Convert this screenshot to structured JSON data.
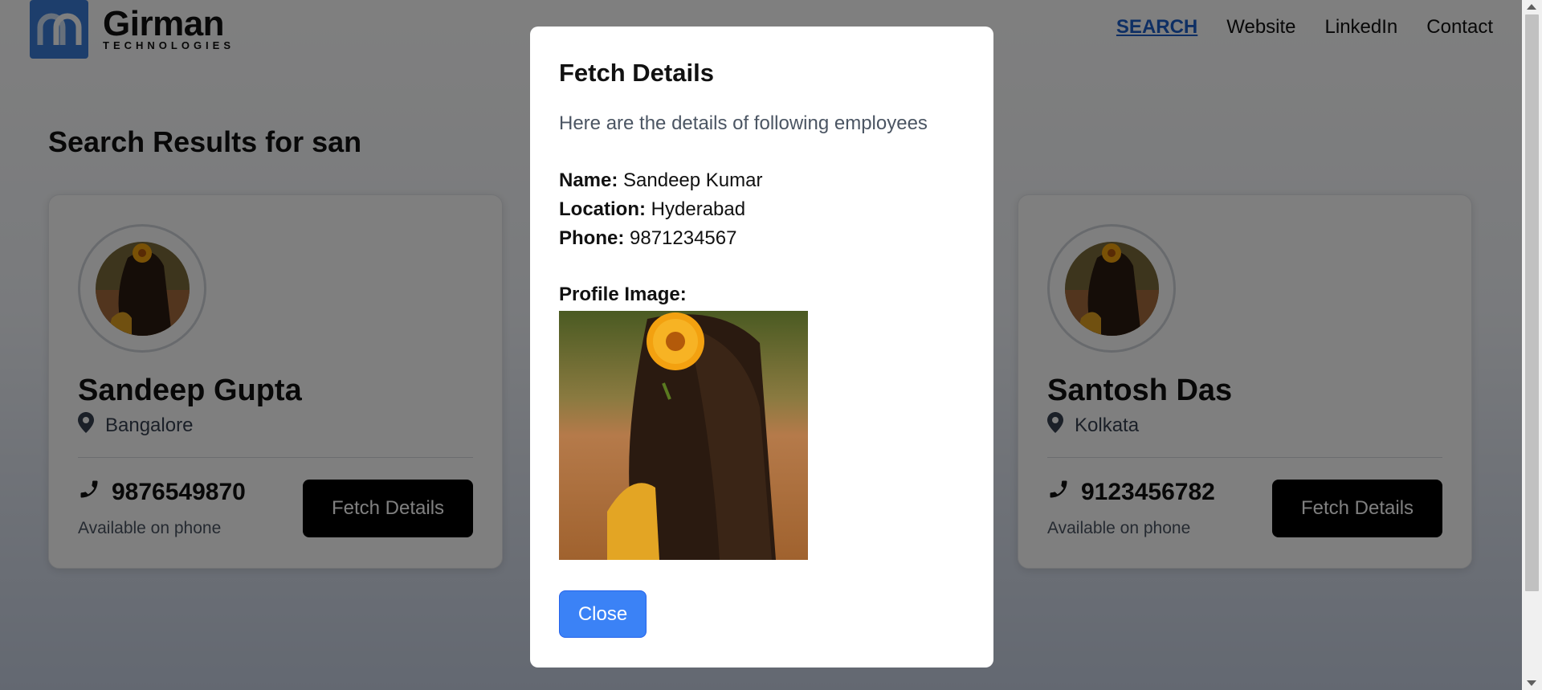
{
  "brand": {
    "name": "Girman",
    "subtitle": "TECHNOLOGIES",
    "color": "#3b7dd8"
  },
  "nav": {
    "items": [
      {
        "label": "SEARCH",
        "active": true
      },
      {
        "label": "Website"
      },
      {
        "label": "LinkedIn"
      },
      {
        "label": "Contact"
      }
    ]
  },
  "results": {
    "title": "Search Results for san"
  },
  "cards": [
    {
      "name": "Sandeep Gupta",
      "location": "Bangalore",
      "phone": "9876549870",
      "availability": "Available on phone",
      "button": "Fetch Details"
    },
    {
      "name": "Santosh Das",
      "location": "Kolkata",
      "phone": "9123456782",
      "availability": "Available on phone",
      "button": "Fetch Details"
    }
  ],
  "modal": {
    "title": "Fetch Details",
    "intro": "Here are the details of following employees",
    "name_label": "Name:",
    "name_value": "Sandeep Kumar",
    "location_label": "Location:",
    "location_value": "Hyderabad",
    "phone_label": "Phone:",
    "phone_value": "9871234567",
    "profile_label": "Profile Image:",
    "close": "Close",
    "close_color": "#3b82f6"
  },
  "icons": {
    "location": "map-pin-icon",
    "phone": "phone-icon"
  }
}
